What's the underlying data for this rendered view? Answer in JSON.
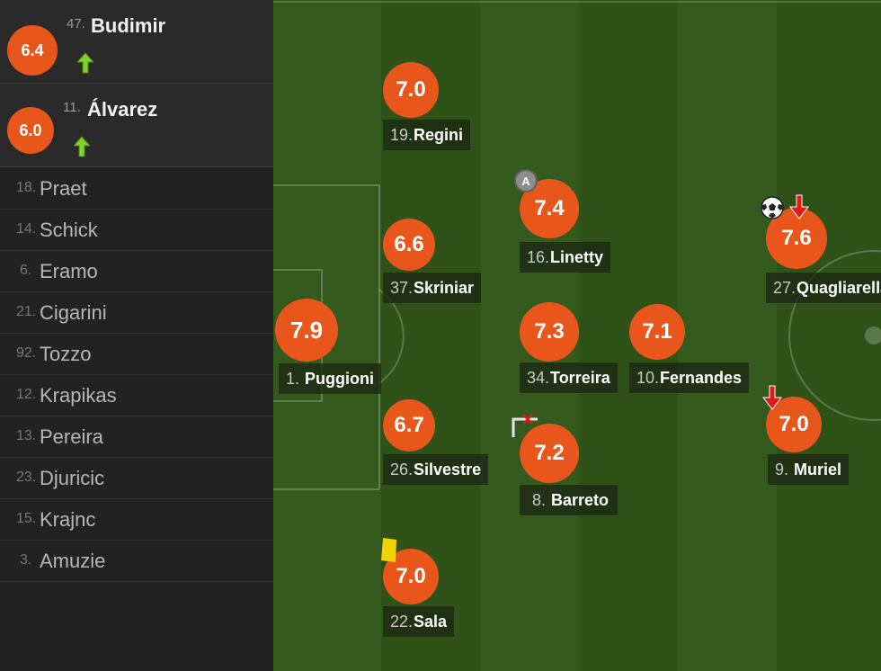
{
  "subs": [
    {
      "number": "47.",
      "name": "Budimir",
      "rating": "6.4",
      "icon": "sub-in-arrow-icon"
    },
    {
      "number": "11.",
      "name": "Álvarez",
      "rating": "6.0",
      "icon": "sub-in-arrow-icon"
    }
  ],
  "bench": [
    {
      "number": "18.",
      "name": "Praet"
    },
    {
      "number": "14.",
      "name": "Schick"
    },
    {
      "number": "6.",
      "name": "Eramo"
    },
    {
      "number": "21.",
      "name": "Cigarini"
    },
    {
      "number": "92.",
      "name": "Tozzo"
    },
    {
      "number": "12.",
      "name": "Krapikas"
    },
    {
      "number": "13.",
      "name": "Pereira"
    },
    {
      "number": "23.",
      "name": "Djuricic"
    },
    {
      "number": "15.",
      "name": "Krajnc"
    },
    {
      "number": "3.",
      "name": "Amuzie"
    }
  ],
  "players": [
    {
      "key": "puggioni",
      "number": "1.",
      "name": "Puggioni",
      "rating": "7.9"
    },
    {
      "key": "regini",
      "number": "19.",
      "name": "Regini",
      "rating": "7.0"
    },
    {
      "key": "skriniar",
      "number": "37.",
      "name": "Skriniar",
      "rating": "6.6"
    },
    {
      "key": "silvestre",
      "number": "26.",
      "name": "Silvestre",
      "rating": "6.7"
    },
    {
      "key": "sala",
      "number": "22.",
      "name": "Sala",
      "rating": "7.0"
    },
    {
      "key": "linetty",
      "number": "16.",
      "name": "Linetty",
      "rating": "7.4"
    },
    {
      "key": "torreira",
      "number": "34.",
      "name": "Torreira",
      "rating": "7.3"
    },
    {
      "key": "barreto",
      "number": "8.",
      "name": "Barreto",
      "rating": "7.2"
    },
    {
      "key": "fernandes",
      "number": "10.",
      "name": "Fernandes",
      "rating": "7.1"
    },
    {
      "key": "quagliarella",
      "number": "27.",
      "name": "Quagliarella",
      "rating": "7.6"
    },
    {
      "key": "muriel",
      "number": "9.",
      "name": "Muriel",
      "rating": "7.0"
    }
  ],
  "markers": {
    "captain_label": "A",
    "icons": [
      "captain-badge-icon",
      "yellow-card-icon",
      "goal-ball-icon",
      "sub-out-arrow-icon",
      "missed-shot-icon"
    ]
  },
  "colors": {
    "rating_badge": "#e8561c",
    "pitch_light": "#355a1d",
    "pitch_dark": "#2e5218",
    "sub_in": "#7fd12c",
    "sub_out": "#e01919",
    "yellow_card": "#f2d200"
  }
}
